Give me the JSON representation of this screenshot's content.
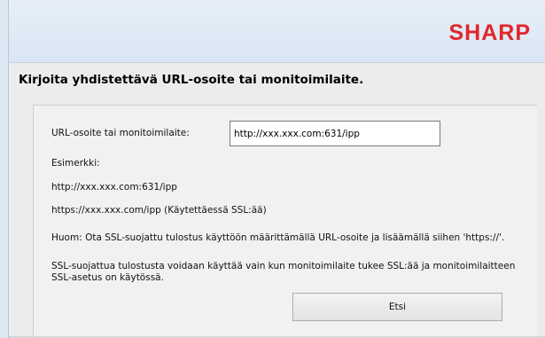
{
  "header": {
    "logo_text": "SHARP",
    "logo_color": "#e2262b"
  },
  "heading": "Kirjoita yhdistettävä URL-osoite tai monitoimilaite.",
  "form": {
    "url_label": "URL-osoite tai monitoimilaite:",
    "url_value": "http://xxx.xxx.com:631/ipp",
    "example_title": "Esimerkki:",
    "example_1": "http://xxx.xxx.com:631/ipp",
    "example_2": "https://xxx.xxx.com/ipp (Käytettäessä SSL:ää)",
    "note": "Huom: Ota SSL-suojattu tulostus käyttöön määrittämällä URL-osoite ja lisäämällä siihen 'https://'.",
    "ssl_text": "SSL-suojattua tulostusta voidaan käyttää vain kun monitoimilaite tukee SSL:ää ja monitoimilaitteen SSL-asetus on käytössä.",
    "search_button": "Etsi"
  }
}
